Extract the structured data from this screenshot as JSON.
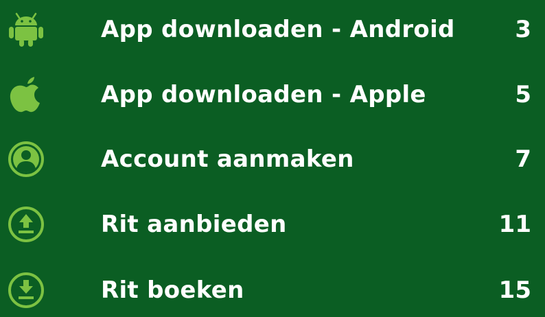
{
  "colors": {
    "background": "#0b5e23",
    "icon": "#7cc242",
    "text": "#ffffff"
  },
  "toc": {
    "items": [
      {
        "icon": "android-icon",
        "label": "App downloaden - Android",
        "page": "3"
      },
      {
        "icon": "apple-icon",
        "label": "App downloaden - Apple",
        "page": "5"
      },
      {
        "icon": "user-circle-icon",
        "label": "Account aanmaken",
        "page": "7"
      },
      {
        "icon": "upload-circle-icon",
        "label": "Rit aanbieden",
        "page": "11"
      },
      {
        "icon": "download-circle-icon",
        "label": "Rit boeken",
        "page": "15"
      }
    ]
  }
}
